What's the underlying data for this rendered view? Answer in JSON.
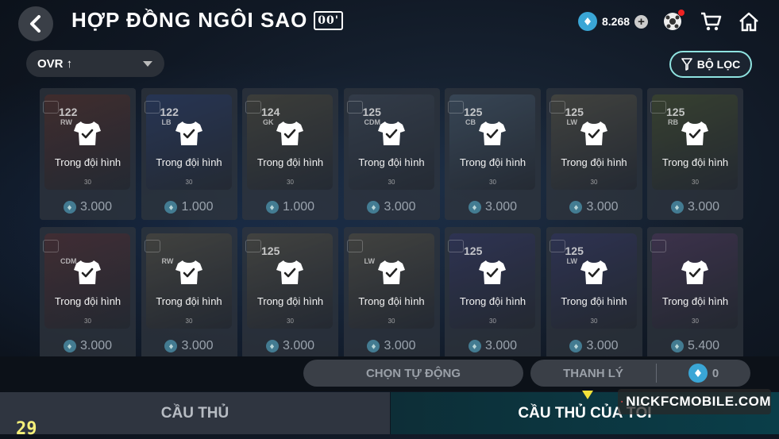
{
  "header": {
    "title": "HỢP ĐỒNG NGÔI SAO",
    "title_badge": "00'",
    "currency_value": "8.268",
    "icons": [
      "back-arrow-icon",
      "fc-coin-icon",
      "plus-icon",
      "football-event-icon",
      "shopping-cart-icon",
      "home-icon"
    ]
  },
  "sort": {
    "label": "OVR ↑",
    "icon": "chevron-down-icon"
  },
  "filter": {
    "label": "BỘ LỌC",
    "icon": "filter-icon"
  },
  "cards": [
    {
      "ovr": "122",
      "pos": "RW",
      "status": "Trong đội hình",
      "level": "30",
      "price": "3.000",
      "art": "#8a3b2c"
    },
    {
      "ovr": "122",
      "pos": "LB",
      "status": "Trong đội hình",
      "level": "30",
      "price": "1.000",
      "art": "#3456a8"
    },
    {
      "ovr": "124",
      "pos": "GK",
      "status": "Trong đội hình",
      "level": "30",
      "price": "1.000",
      "art": "#7a7050"
    },
    {
      "ovr": "125",
      "pos": "CDM",
      "status": "Trong đội hình",
      "level": "30",
      "price": "3.000",
      "art": "#5a6a80"
    },
    {
      "ovr": "125",
      "pos": "CB",
      "status": "Trong đội hình",
      "level": "30",
      "price": "3.000",
      "art": "#6a8aa8"
    },
    {
      "ovr": "125",
      "pos": "LW",
      "status": "Trong đội hình",
      "level": "30",
      "price": "3.000",
      "art": "#8a8060"
    },
    {
      "ovr": "125",
      "pos": "RB",
      "status": "Trong đội hình",
      "level": "30",
      "price": "3.000",
      "art": "#6a7a30"
    },
    {
      "ovr": "",
      "pos": "CDM",
      "status": "Trong đội hình",
      "level": "30",
      "price": "3.000",
      "art": "#8a3a3a"
    },
    {
      "ovr": "",
      "pos": "RW",
      "status": "Trong đội hình",
      "level": "30",
      "price": "3.000",
      "art": "#8a7c5c"
    },
    {
      "ovr": "125",
      "pos": "",
      "status": "Trong đội hình",
      "level": "30",
      "price": "3.000",
      "art": "#8a7c5c"
    },
    {
      "ovr": "",
      "pos": "LW",
      "status": "Trong đội hình",
      "level": "30",
      "price": "3.000",
      "art": "#8a7c5c"
    },
    {
      "ovr": "125",
      "pos": "",
      "status": "Trong đội hình",
      "level": "30",
      "price": "3.000",
      "art": "#4a4a9a"
    },
    {
      "ovr": "125",
      "pos": "LW",
      "status": "Trong đội hình",
      "level": "30",
      "price": "3.000",
      "art": "#4a4a9a"
    },
    {
      "ovr": "",
      "pos": "",
      "status": "Trong đội hình",
      "level": "30",
      "price": "5.400",
      "art": "#7a4a8a"
    }
  ],
  "actions": {
    "auto_select": "CHỌN TỰ ĐỘNG",
    "sell": "THANH LÝ",
    "sell_total": "0"
  },
  "tabs": {
    "players": "CẦU THỦ",
    "my_players": "CẦU THỦ CỦA TÔI"
  },
  "watermark": "NICKFCMOBILE.COM",
  "corner_number": "29",
  "colors": {
    "accent": "#8fe3e0",
    "coin": "#3aa6d6",
    "indicator": "#f2e23a",
    "tab_active": "#0a3e49"
  }
}
